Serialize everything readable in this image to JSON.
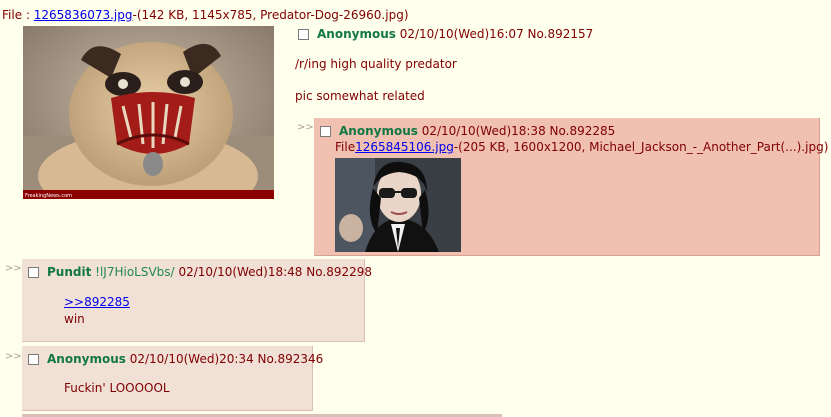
{
  "op": {
    "file_prefix": "File : ",
    "file_link": "1265836073.jpg",
    "file_meta": "-(142 KB, 1145x785, Predator-Dog-26960.jpg)",
    "thumb_caption": "FreakingNews.com",
    "name": "Anonymous",
    "datetime": "02/10/10(Wed)16:07",
    "number": "No.892157",
    "comment_line1": "/r/ing high quality predator",
    "comment_line2": "pic somewhat related"
  },
  "replies": [
    {
      "doubledash": ">>",
      "name": "Anonymous",
      "datetime": "02/10/10(Wed)18:38",
      "number": "No.892285",
      "file_prefix": "File",
      "file_link": "1265845106.jpg",
      "file_meta": "-(205 KB, 1600x1200, Michael_Jackson_-_Another_Part(...).jpg)"
    },
    {
      "doubledash": ">>",
      "name": "Pundit",
      "tripcode": "!lJ7HioLSVbs/",
      "datetime": "02/10/10(Wed)18:48",
      "number": "No.892298",
      "quote_link": ">>892285",
      "comment": "win"
    },
    {
      "doubledash": ">>",
      "name": "Anonymous",
      "datetime": "02/10/10(Wed)20:34",
      "number": "No.892346",
      "comment": "Fuckin' LOOOOOL"
    }
  ],
  "colors": {
    "background": "#ffffee",
    "name": "#117743",
    "text": "#800000",
    "reply_bg": "#f0e0d6",
    "reply_highlight_bg": "#f0c0b0",
    "link": "#0000ee"
  }
}
